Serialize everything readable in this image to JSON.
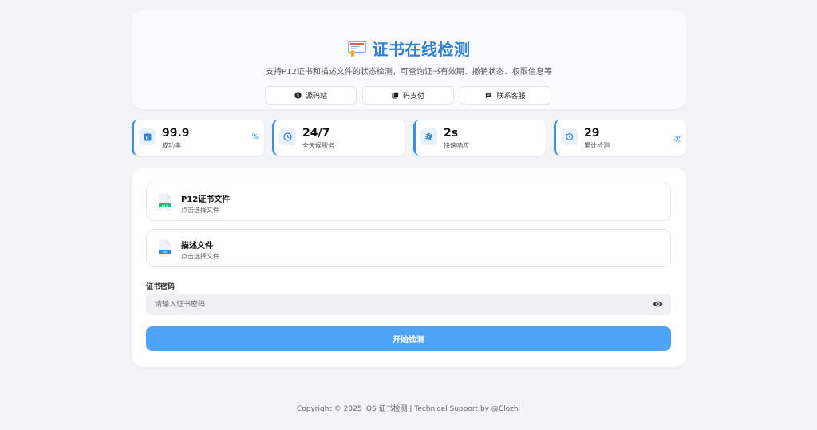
{
  "header": {
    "title": "证书在线检测",
    "subtitle": "支持P12证书和描述文件的状态检测，可查询证书有效期、撤销状态、权限信息等",
    "buttons": [
      {
        "label": "源码站",
        "icon": "dollar-circle-icon"
      },
      {
        "label": "码支付",
        "icon": "cards-icon"
      },
      {
        "label": "联系客服",
        "icon": "chat-icon"
      }
    ]
  },
  "stats": [
    {
      "value": "99.9",
      "label": "成功率",
      "unit": "%",
      "icon": "chart-icon"
    },
    {
      "value": "24/7",
      "label": "全天候服务",
      "unit": "",
      "icon": "clock-icon"
    },
    {
      "value": "2s",
      "label": "快速响应",
      "unit": "",
      "icon": "gear-icon"
    },
    {
      "value": "29",
      "label": "累计检测",
      "unit": "次",
      "icon": "history-icon"
    }
  ],
  "upload": {
    "p12": {
      "name": "P12证书文件",
      "hint": "点击选择文件",
      "badge": "p12"
    },
    "profile": {
      "name": "描述文件",
      "hint": "点击选择文件",
      "badge": "mp"
    }
  },
  "password": {
    "label": "证书密码",
    "placeholder": "请输入证书密码"
  },
  "start_button": "开始检测",
  "footer": "Copyright © 2025 iOS 证书检测 | Technical Support by @Clozhi",
  "colors": {
    "accent": "#2f80d6",
    "button": "#4fa3f7",
    "p12_badge": "#2bb673",
    "mp_badge": "#2d8fd5"
  }
}
